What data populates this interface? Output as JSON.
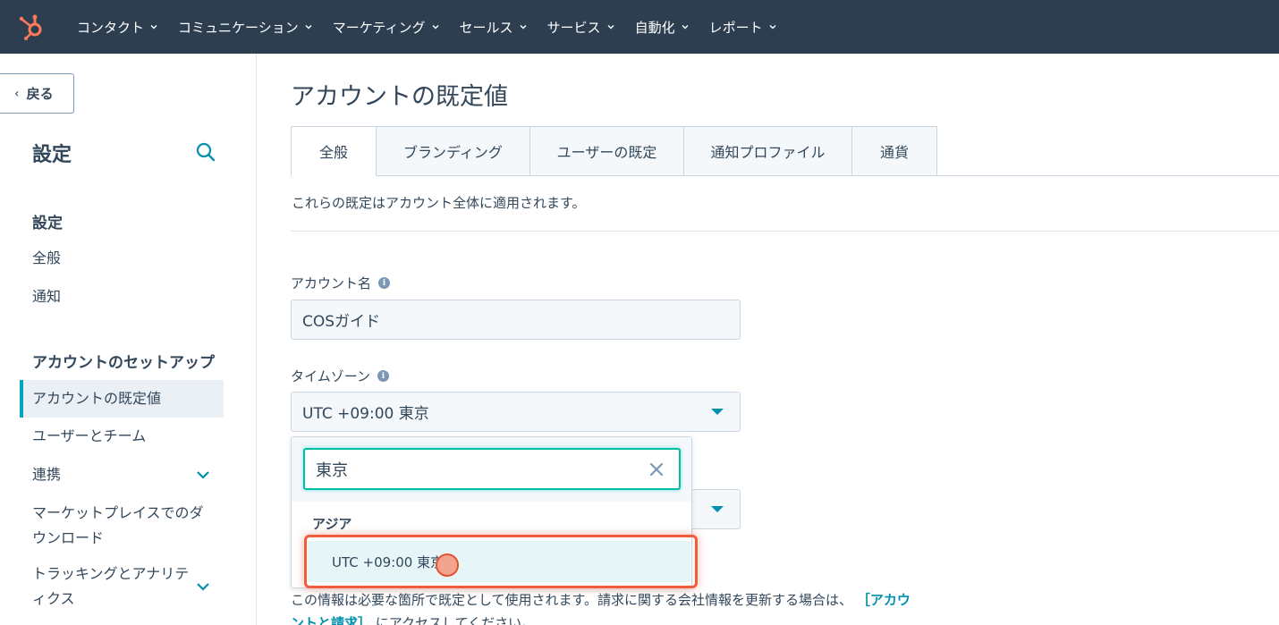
{
  "nav": {
    "items": [
      {
        "label": "コンタクト"
      },
      {
        "label": "コミュニケーション"
      },
      {
        "label": "マーケティング"
      },
      {
        "label": "セールス"
      },
      {
        "label": "サービス"
      },
      {
        "label": "自動化"
      },
      {
        "label": "レポート"
      }
    ],
    "brand_color": "#ff7a59",
    "bg_color": "#2d3e50"
  },
  "sidebar": {
    "back_label": "戻る",
    "title": "設定",
    "section1": {
      "heading": "設定",
      "items": [
        "全般",
        "通知"
      ]
    },
    "section2": {
      "heading": "アカウントのセットアップ",
      "items": [
        {
          "label": "アカウントの既定値",
          "active": true
        },
        {
          "label": "ユーザーとチーム"
        },
        {
          "label": "連携",
          "expandable": true
        },
        {
          "label_line1": "マーケットプレイスでのダ",
          "label_line2": "ウンロード"
        },
        {
          "label_line1": "トラッキングとアナリテ",
          "label_line2": "ィクス",
          "expandable": true
        }
      ]
    }
  },
  "main": {
    "title": "アカウントの既定値",
    "tabs": [
      "全般",
      "ブランディング",
      "ユーザーの既定",
      "通知プロファイル",
      "通貨"
    ],
    "intro": "これらの既定はアカウント全体に適用されます。",
    "account_name_label": "アカウント名",
    "account_name_value": "COSガイド",
    "timezone_label": "タイムゾーン",
    "timezone_value": "UTC +09:00 東京",
    "dropdown": {
      "search_value": "東京",
      "group": "アジア",
      "option": "UTC +09:00 東京"
    },
    "footer_text": "この情報は必要な箇所で既定として使用されます。請求に関する会社情報を更新する場合は、",
    "footer_link_1": "［アカウ",
    "footer_link_2": "ントと請求］",
    "footer_text_end": "にアクセスしてください。",
    "accent_color": "#00a4bd"
  }
}
